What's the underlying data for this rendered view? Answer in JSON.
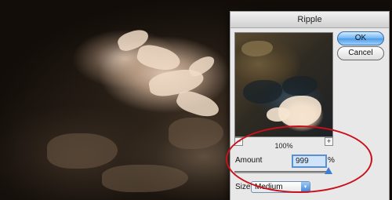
{
  "dialog": {
    "title": "Ripple",
    "ok_label": "OK",
    "cancel_label": "Cancel",
    "zoom_in_glyph": "+",
    "zoom_out_glyph": "−",
    "zoom_level": "100%",
    "amount_label": "Amount",
    "amount_value": "999",
    "amount_unit": "%",
    "amount_slider_fraction": 1.0,
    "size_label": "Size",
    "size_selected": "Medium",
    "size_dropdown_glyph": "▾"
  },
  "colors": {
    "highlight_ellipse": "#c8101a",
    "primary_button": "#4b9be6"
  }
}
